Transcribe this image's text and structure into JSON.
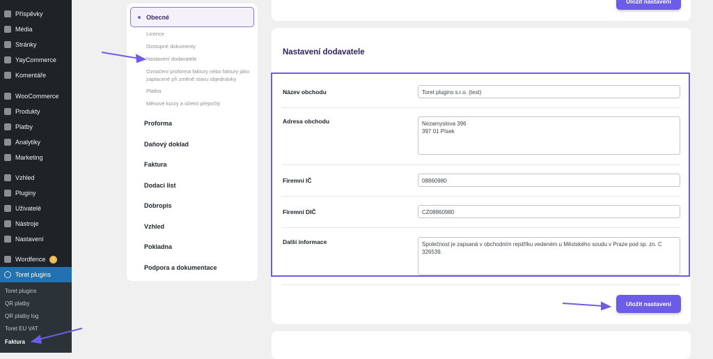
{
  "sidebar": {
    "items": [
      "Příspěvky",
      "Média",
      "Stránky",
      "YayCommerce",
      "Komentáře",
      "WooCommerce",
      "Produkty",
      "Platby",
      "Analytiky",
      "Marketing",
      "Vzhled",
      "Pluginy",
      "Uživatelé",
      "Nástroje",
      "Nastavení",
      "Wordfence",
      "Toret plugins"
    ],
    "wordfence_badge": "1",
    "submenu": [
      "Toret plugins",
      "QR platby",
      "QR platby log",
      "Toret EU VAT",
      "Faktura"
    ]
  },
  "nav": {
    "selected": "Obecné",
    "subitems": [
      "Licence",
      "Dostupné dokumenty",
      "Nastavení dodavatele",
      "Označení proforma faktury nebo faktury jako zaplacené při změně stavu objednávky",
      "Platba",
      "Měnové kurzy a účetní přepočty"
    ],
    "sections": [
      "Proforma",
      "Daňový doklad",
      "Faktura",
      "Dodací list",
      "Dobropis",
      "Vzhled",
      "Pokladna",
      "Podpora a dokumentace"
    ]
  },
  "main": {
    "title": "Nastavení dodavatele",
    "save_label": "Uložit nastavení",
    "fields": [
      {
        "label": "Název obchodu",
        "value": "Toret plugins s.r.o. (test)"
      },
      {
        "label": "Adresa obchodu",
        "value": "Nezamyslova 396\n397 01 Písek"
      },
      {
        "label": "Firemní IČ",
        "value": "08860980"
      },
      {
        "label": "Firemní DIČ",
        "value": "CZ08860980"
      },
      {
        "label": "Další informace",
        "value": "Společnost je zapsaná v obchodním rejstříku vedeném u Městského soudu v Praze pod sp. zn. C 326539."
      }
    ]
  },
  "colors": {
    "accent": "#6c5ce7",
    "sidebar": "#1d2327",
    "active": "#2271b1"
  }
}
